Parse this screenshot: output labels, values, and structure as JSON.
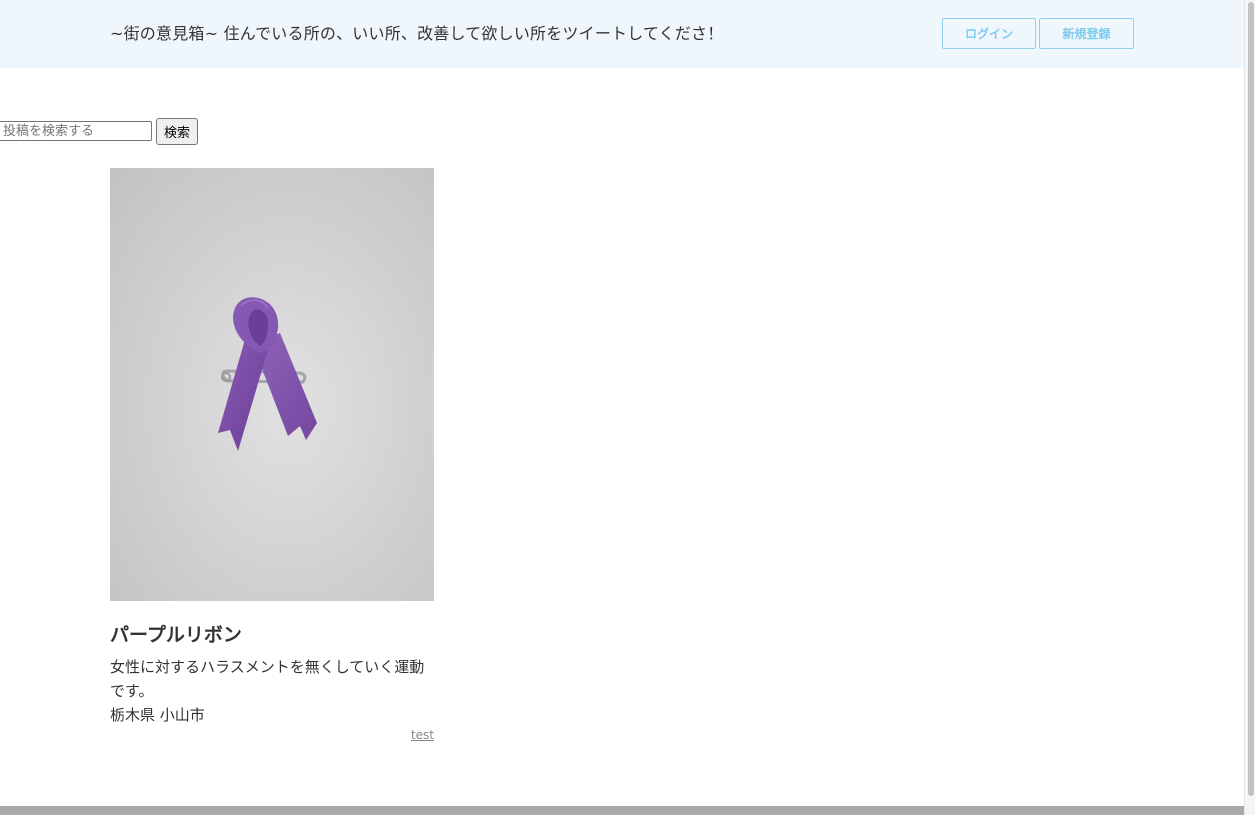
{
  "header": {
    "title": "~街の意見箱~ 住んでいる所の、いい所、改善して欲しい所をツイートしてくださ！",
    "login_label": "ログイン",
    "signup_label": "新規登録",
    "background_color": "#f0f7fc",
    "button_color": "#7ccbf0"
  },
  "search": {
    "placeholder": "投稿を検索する",
    "value": "",
    "button_label": "検索"
  },
  "posts": [
    {
      "image_icon": "purple-ribbon-photo",
      "title": "パープルリボン",
      "description": "女性に対するハラスメントを無くしていく運動です。",
      "location": "栃木県 小山市",
      "user": "test",
      "ribbon_color": "#7e4fa8"
    }
  ]
}
